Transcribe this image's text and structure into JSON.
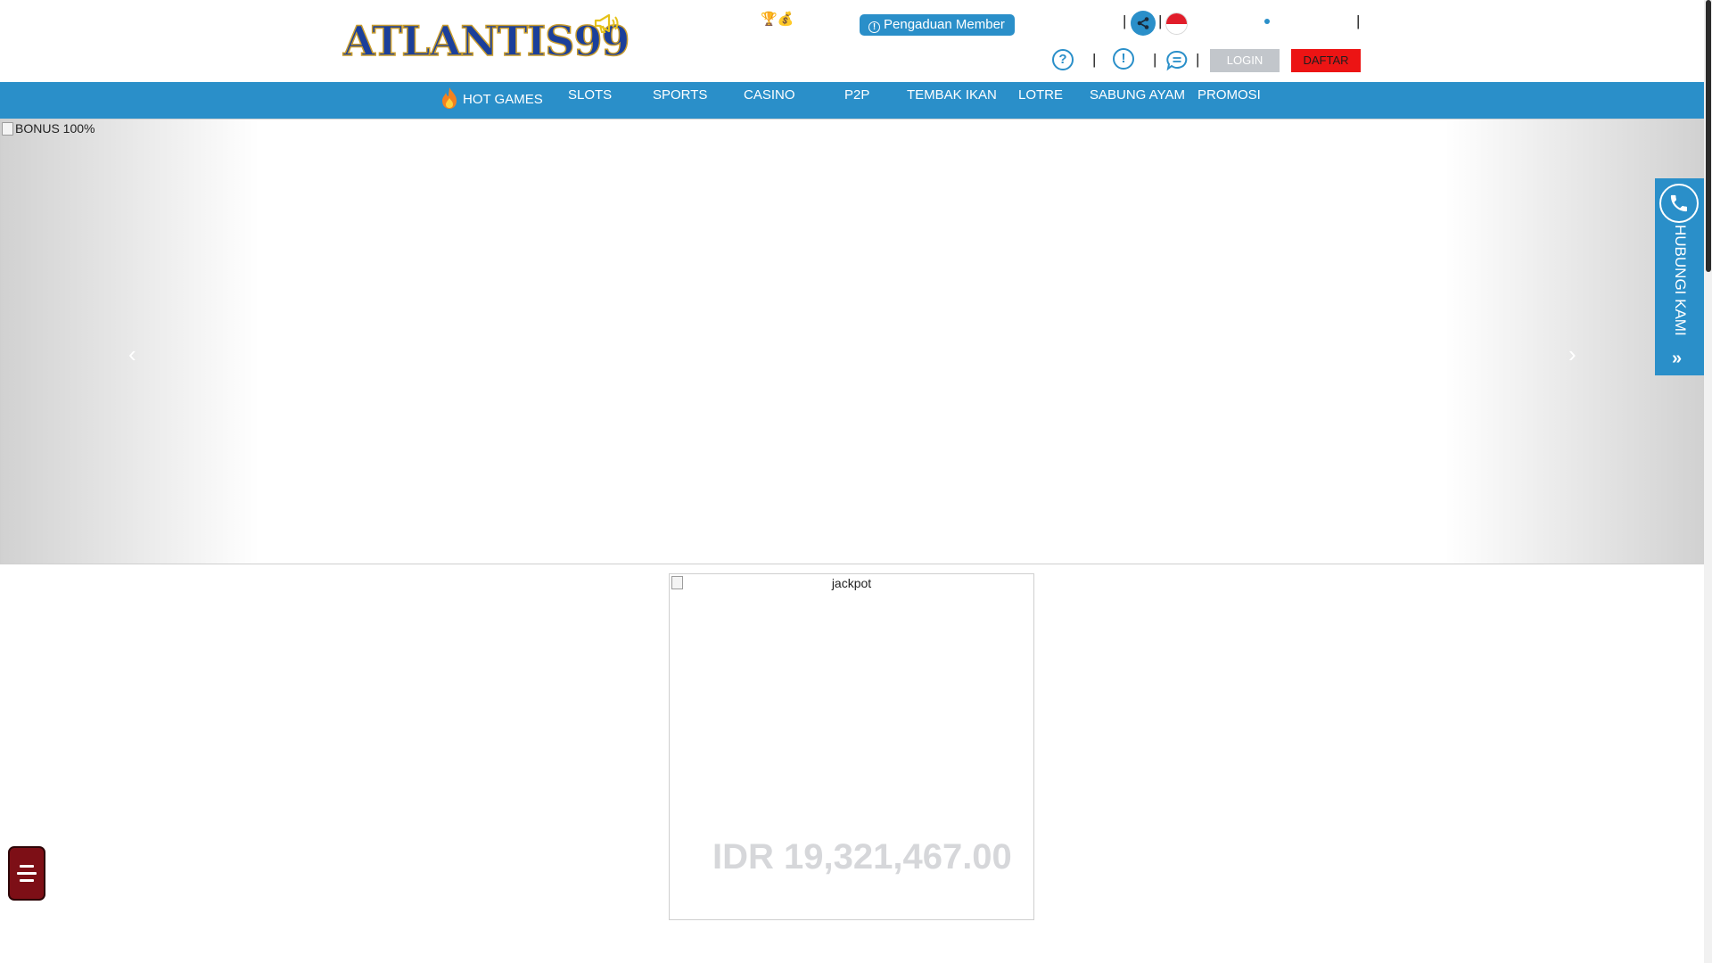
{
  "header": {
    "logo_text": "ATLANTIS99",
    "trophy_text": "🏆💰",
    "complaint_button": "Pengaduan Member",
    "separator": "|",
    "help_icon_text": "?",
    "info_icon_text": "!",
    "login_label": "LOGIN",
    "register_label": "DAFTAR"
  },
  "nav": {
    "hot_games": "HOT GAMES",
    "items": [
      "SLOTS",
      "SPORTS",
      "CASINO",
      "P2P",
      "TEMBAK IKAN",
      "LOTRE",
      "SABUNG AYAM",
      "PROMOSI"
    ]
  },
  "banner": {
    "image_alt": "BONUS 100%",
    "prev_arrow": "‹",
    "next_arrow": "›"
  },
  "contact": {
    "label": "HUBUNGI KAMI",
    "chevron": "»"
  },
  "jackpot": {
    "image_alt": "jackpot",
    "amount": "IDR 19,321,467.00"
  },
  "colors": {
    "primary": "#2a8fc9",
    "register": "#ec1414",
    "login": "#c2c6cb",
    "menu_button": "#7d0f16",
    "logo_blue": "#1b3f9a",
    "logo_gold": "#c99c2c"
  },
  "icons": {
    "megaphone": "megaphone-icon",
    "share": "share-icon",
    "flag": "indonesia-flag-icon",
    "help": "help-icon",
    "info": "info-icon",
    "chat": "chat-icon",
    "phone": "phone-icon",
    "hot": "fire-icon",
    "menu": "menu-icon"
  }
}
